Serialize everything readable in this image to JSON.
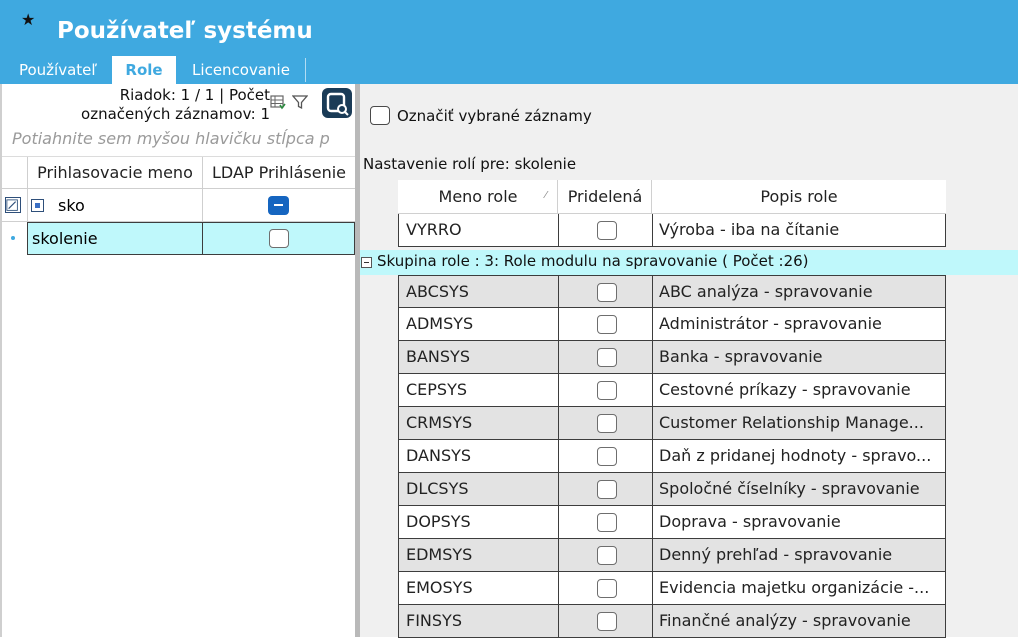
{
  "header": {
    "title": "Používateľ systému",
    "tabs": [
      {
        "label": "Používateľ",
        "active": false
      },
      {
        "label": "Role",
        "active": true
      },
      {
        "label": "Licencovanie",
        "active": false
      }
    ]
  },
  "left_panel": {
    "row_info_line1": "Riadok: 1 / 1 | Počet",
    "row_info_line2": "označených záznamov: 1",
    "drag_hint": "Potiahnite sem myšou hlavičku stĺpca p",
    "columns": [
      "Prihlasovacie meno",
      "LDAP Prihlásenie"
    ],
    "filter_row": {
      "value": "sko",
      "ldap": "indeterminate"
    },
    "rows": [
      {
        "login": "skolenie",
        "ldap": false,
        "current": true
      }
    ]
  },
  "right_panel": {
    "mark_selected_label": "Označiť vybrané záznamy",
    "settings_label": "Nastavenie rolí pre: skolenie",
    "columns": [
      "Meno role",
      "Pridelená",
      "Popis role"
    ],
    "top_row": {
      "name": "VYRRO",
      "assigned": false,
      "description": "Výroba - iba na čítanie"
    },
    "group": {
      "label": "Skupina role : 3: Role modulu na spravovanie ( Počet :26)"
    },
    "rows": [
      {
        "name": "ABCSYS",
        "assigned": false,
        "description": "ABC analýza - spravovanie"
      },
      {
        "name": "ADMSYS",
        "assigned": false,
        "description": "Administrátor - spravovanie"
      },
      {
        "name": "BANSYS",
        "assigned": false,
        "description": "Banka - spravovanie"
      },
      {
        "name": "CEPSYS",
        "assigned": false,
        "description": "Cestovné príkazy - spravovanie"
      },
      {
        "name": "CRMSYS",
        "assigned": false,
        "description": "Customer Relationship Manage..."
      },
      {
        "name": "DANSYS",
        "assigned": false,
        "description": "Daň z pridanej hodnoty - spravo..."
      },
      {
        "name": "DLCSYS",
        "assigned": false,
        "description": "Spoločné číselníky - spravovanie"
      },
      {
        "name": "DOPSYS",
        "assigned": false,
        "description": "Doprava - spravovanie"
      },
      {
        "name": "EDMSYS",
        "assigned": false,
        "description": "Denný prehľad - spravovanie"
      },
      {
        "name": "EMOSYS",
        "assigned": false,
        "description": "Evidencia majetku organizácie -..."
      },
      {
        "name": "FINSYS",
        "assigned": false,
        "description": "Finančné analýzy - spravovanie"
      }
    ]
  },
  "colors": {
    "header_bg": "#3fa9e0",
    "group_bg": "#bff8fb",
    "selected_row_bg": "#bff8fb",
    "alt_row_bg": "#e3e3e3"
  }
}
